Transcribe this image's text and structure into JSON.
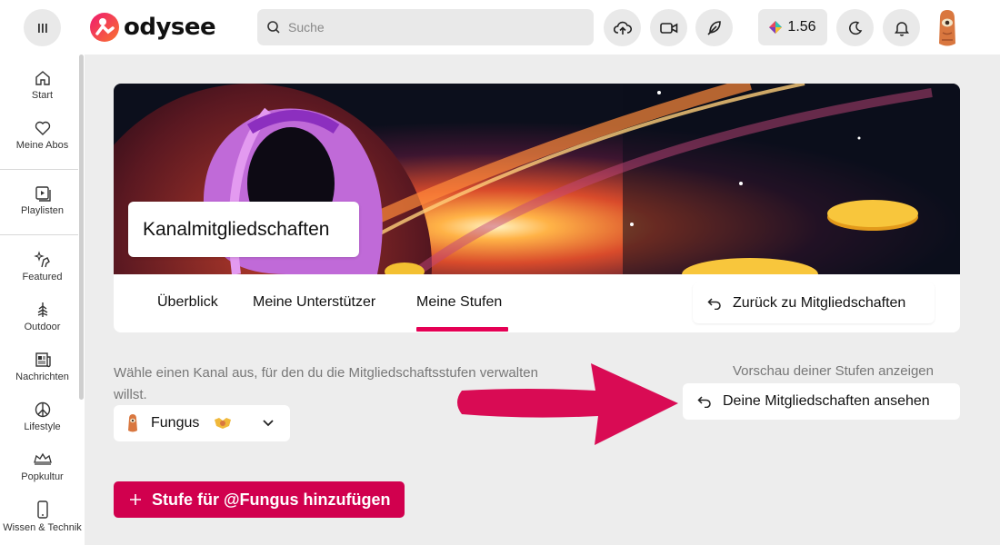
{
  "header": {
    "logo_text": "odysee",
    "search_placeholder": "Suche",
    "credits": "1.56"
  },
  "sidebar": {
    "items": [
      {
        "label": "Start",
        "icon": "home-icon"
      },
      {
        "label": "Meine Abos",
        "icon": "heart-icon"
      },
      {
        "label": "Playlisten",
        "icon": "playlist-icon"
      },
      {
        "label": "Featured",
        "icon": "featured-icon"
      },
      {
        "label": "Outdoor",
        "icon": "tree-icon"
      },
      {
        "label": "Nachrichten",
        "icon": "news-icon"
      },
      {
        "label": "Lifestyle",
        "icon": "peace-icon"
      },
      {
        "label": "Popkultur",
        "icon": "popculture-icon"
      },
      {
        "label": "Wissen & Technik",
        "icon": "phone-icon"
      }
    ]
  },
  "page": {
    "title": "Kanalmitgliedschaften",
    "tabs": [
      {
        "label": "Überblick"
      },
      {
        "label": "Meine Unterstützer"
      },
      {
        "label": "Meine Stufen"
      }
    ],
    "active_tab": "Meine Stufen",
    "back_label": "Zurück zu Mitgliedschaften",
    "description": "Wähle einen Kanal aus, für den du die Mitgliedschaftsstufen verwalten willst.",
    "selected_channel": "Fungus",
    "preview_label": "Vorschau deiner Stufen anzeigen",
    "view_label": "Deine Mitgliedschaften ansehen",
    "add_label": "Stufe für @Fungus hinzufügen"
  },
  "colors": {
    "accent": "#e50054",
    "button_primary": "#d1004e",
    "background": "#ededed"
  }
}
